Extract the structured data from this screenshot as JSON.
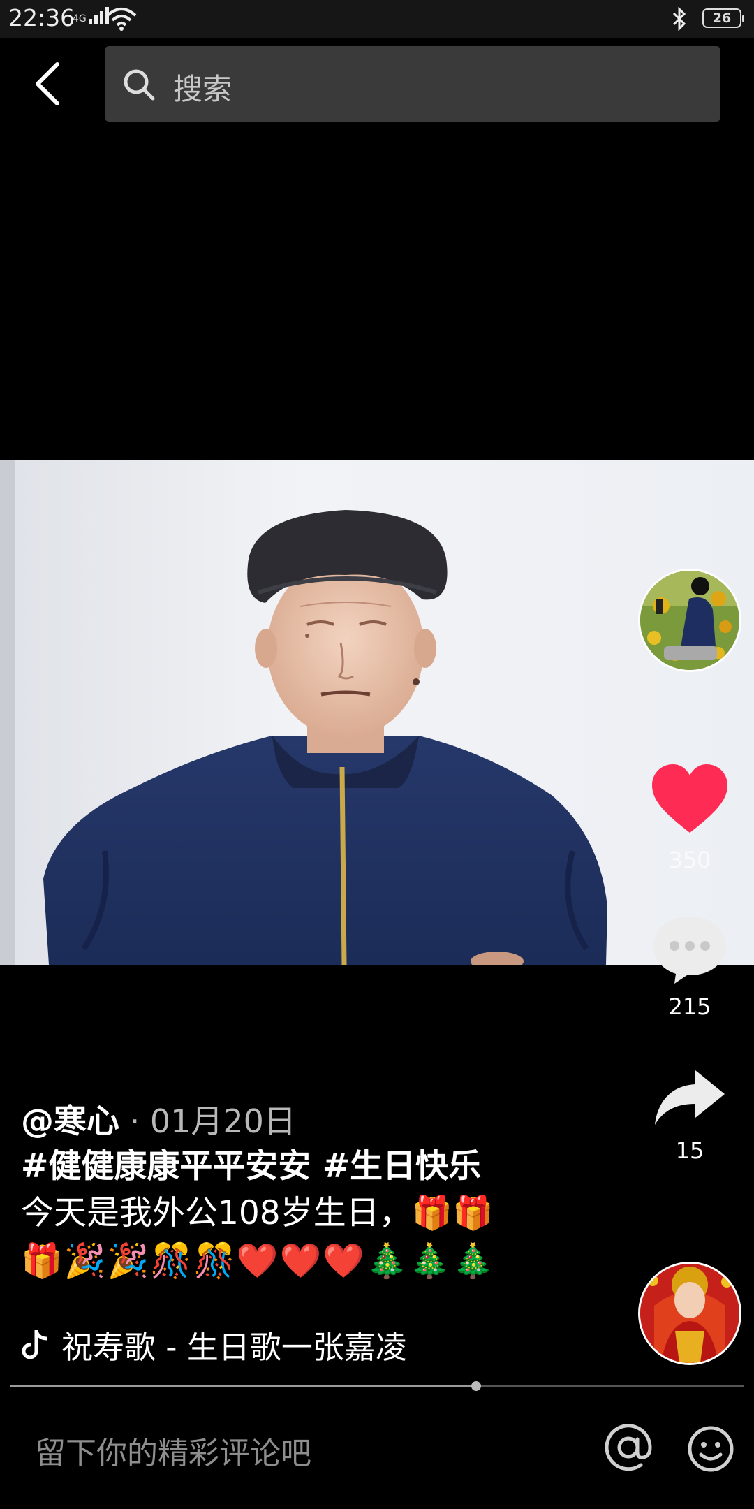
{
  "status_bar": {
    "time": "22:36",
    "network": "4G",
    "battery": "26",
    "icons": [
      "signal-icon",
      "wifi-icon",
      "bluetooth-icon",
      "battery-icon"
    ]
  },
  "search": {
    "placeholder": "搜索"
  },
  "actions": {
    "like_count": "350",
    "comment_count": "215",
    "share_count": "15",
    "like_color": "#fe2c55"
  },
  "caption": {
    "author": "@寒心",
    "separator": " · ",
    "date": "01月20日",
    "hashtags": "#健健康康平平安安 #生日快乐",
    "text": "今天是我外公108岁生日，🎁🎁",
    "emojis": "🎁🎉🎉🎊🎊❤️❤️❤️🎄🎄🎄"
  },
  "music": {
    "title": "祝寿歌 - 生日歌一张嘉凌"
  },
  "playback": {
    "progress": 0.635
  },
  "comment_bar": {
    "placeholder": "留下你的精彩评论吧"
  }
}
